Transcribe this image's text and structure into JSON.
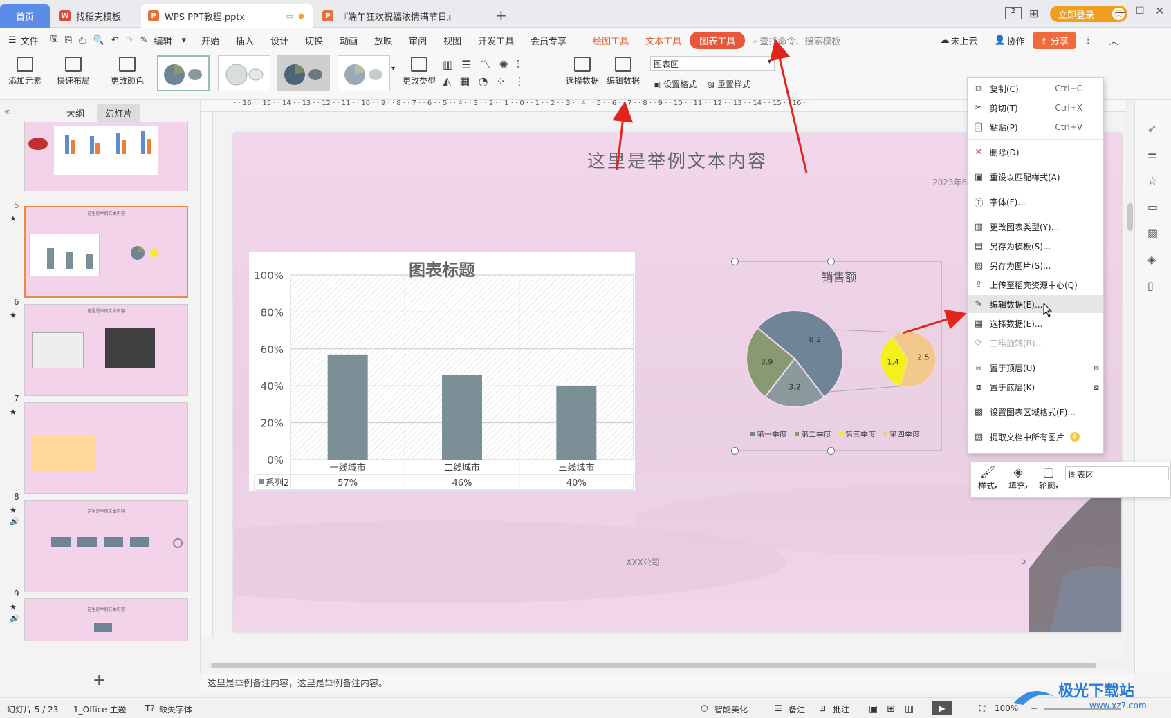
{
  "tabs": [
    {
      "label": "首页"
    },
    {
      "label": "找稻壳模板"
    },
    {
      "label": "WPS PPT教程.pptx"
    },
    {
      "label": "『端午狂欢祝福浓情满节日』"
    }
  ],
  "titlebar": {
    "login": "立即登录",
    "new_tab": "+"
  },
  "menu": {
    "file": "文件",
    "edit": "编辑",
    "items": [
      "开始",
      "插入",
      "设计",
      "切换",
      "动画",
      "放映",
      "审阅",
      "视图",
      "开发工具",
      "会员专享"
    ],
    "draw_tools": "绘图工具",
    "text_tools": "文本工具",
    "chart_tools": "图表工具",
    "search": "查找命令、搜索模板",
    "cloud": "未上云",
    "collab": "协作",
    "share": "分享"
  },
  "ribbon": {
    "add_element": "添加元素",
    "quick_layout": "快速布局",
    "change_color": "更改颜色",
    "change_type": "更改类型",
    "select_data": "选择数据",
    "edit_data": "编辑数据",
    "area_select": "图表区",
    "set_format": "设置格式",
    "reset_style": "重置样式"
  },
  "leftpanel": {
    "outline_tab": "大纲",
    "slides_tab": "幻灯片",
    "slide_numbers": [
      "5",
      "6",
      "7",
      "8",
      "9"
    ],
    "thumb_title": "这里是举例文本内容",
    "add": "+"
  },
  "ruler_text": "· · 16 · · 15 · · 14 · · 13 · · 12 · · 11 · · 10 · · 9 · · 8 · · 7 · · 6 · · 5 · · 4 · · 3 · · 2 · · 1 · · 0 · · 1 · · 2 · · 3 · · 4 · · 5 · · 6 · · 7 · · 8 · · 9 · · 10 · · 11 · · 12 · · 13 · · 14 · · 15 · · 16 · ·",
  "slide": {
    "title": "这里是举例文本内容",
    "date": "2023年6月",
    "company": "XXX公司",
    "page": "5"
  },
  "chart_data": [
    {
      "type": "bar",
      "title": "图表标题",
      "categories": [
        "一线城市",
        "二线城市",
        "三线城市"
      ],
      "series": [
        {
          "name": "系列2",
          "values": [
            57,
            46,
            40
          ]
        }
      ],
      "table_values": [
        "57%",
        "46%",
        "40%"
      ],
      "ylim": [
        0,
        100
      ],
      "yticks": [
        "100%",
        "80%",
        "60%",
        "40%",
        "20%",
        "0%"
      ],
      "color": "#7a9096"
    },
    {
      "type": "pie",
      "title": "销售额",
      "main_pie": [
        {
          "value": 8.2,
          "color": "#6f8597"
        },
        {
          "value": 3.2,
          "color": "#8a999c"
        },
        {
          "value": 3.9,
          "color": "#899a72"
        }
      ],
      "sub_pie": [
        {
          "value": 2.5,
          "color": "#f4c88a"
        },
        {
          "value": 1.4,
          "color": "#f4f01c"
        }
      ],
      "legend": [
        {
          "name": "第一季度",
          "color": "#6f8597"
        },
        {
          "name": "第二季度",
          "color": "#899a72"
        },
        {
          "name": "第三季度",
          "color": "#f4f01c"
        },
        {
          "name": "第四季度",
          "color": "#f4c88a"
        }
      ]
    }
  ],
  "context_menu": {
    "items": [
      {
        "label": "复制(C)",
        "shortcut": "Ctrl+C",
        "icon": "copy-icon",
        "glyph": "⧉"
      },
      {
        "label": "剪切(T)",
        "shortcut": "Ctrl+X",
        "icon": "cut-icon",
        "glyph": "✂"
      },
      {
        "label": "粘贴(P)",
        "shortcut": "Ctrl+V",
        "icon": "paste-icon",
        "glyph": "📋"
      },
      {
        "label": "删除(D)",
        "shortcut": "",
        "icon": "delete-icon",
        "glyph": "✕"
      },
      {
        "label": "重设以匹配样式(A)",
        "shortcut": "",
        "icon": "reset-icon",
        "glyph": "▣"
      },
      {
        "label": "字体(F)...",
        "shortcut": "",
        "icon": "font-icon",
        "glyph": "Ⓣ"
      },
      {
        "label": "更改图表类型(Y)...",
        "shortcut": "",
        "icon": "chart-type-icon",
        "glyph": "▥"
      },
      {
        "label": "另存为模板(S)...",
        "shortcut": "",
        "icon": "template-icon",
        "glyph": "▤"
      },
      {
        "label": "另存为图片(S)...",
        "shortcut": "",
        "icon": "image-icon",
        "glyph": "▨"
      },
      {
        "label": "上传至稻壳资源中心(Q)",
        "shortcut": "",
        "icon": "upload-icon",
        "glyph": "⇪"
      },
      {
        "label": "编辑数据(E)...",
        "shortcut": "",
        "icon": "edit-data-icon",
        "glyph": "✎"
      },
      {
        "label": "选择数据(E)...",
        "shortcut": "",
        "icon": "select-data-icon",
        "glyph": "▦"
      },
      {
        "label": "三维旋转(R)...",
        "shortcut": "",
        "icon": "rotate-3d-icon",
        "glyph": "⟳"
      },
      {
        "label": "置于顶层(U)",
        "shortcut": "",
        "icon": "bring-front-icon",
        "glyph": "⧈"
      },
      {
        "label": "置于底层(K)",
        "shortcut": "",
        "icon": "send-back-icon",
        "glyph": "⧇"
      },
      {
        "label": "设置图表区域格式(F)...",
        "shortcut": "",
        "icon": "format-area-icon",
        "glyph": "▩"
      },
      {
        "label": "提取文档中所有图片",
        "shortcut": "",
        "icon": "extract-images-icon",
        "glyph": "▧"
      }
    ]
  },
  "mini_toolbar": {
    "style": "样式",
    "fill": "填充",
    "outline": "轮廓",
    "area": "图表区"
  },
  "notes": "这里是举例备注内容，这里是举例备注内容。",
  "status": {
    "slide_index": "幻灯片 5 / 23",
    "theme": "1_Office 主题",
    "missing_font": "缺失字体",
    "beautify": "智能美化",
    "notes": "备注",
    "comments": "批注",
    "zoom": "100%"
  },
  "watermark": "极光下载站",
  "watermark_url": "www.xz7.com"
}
